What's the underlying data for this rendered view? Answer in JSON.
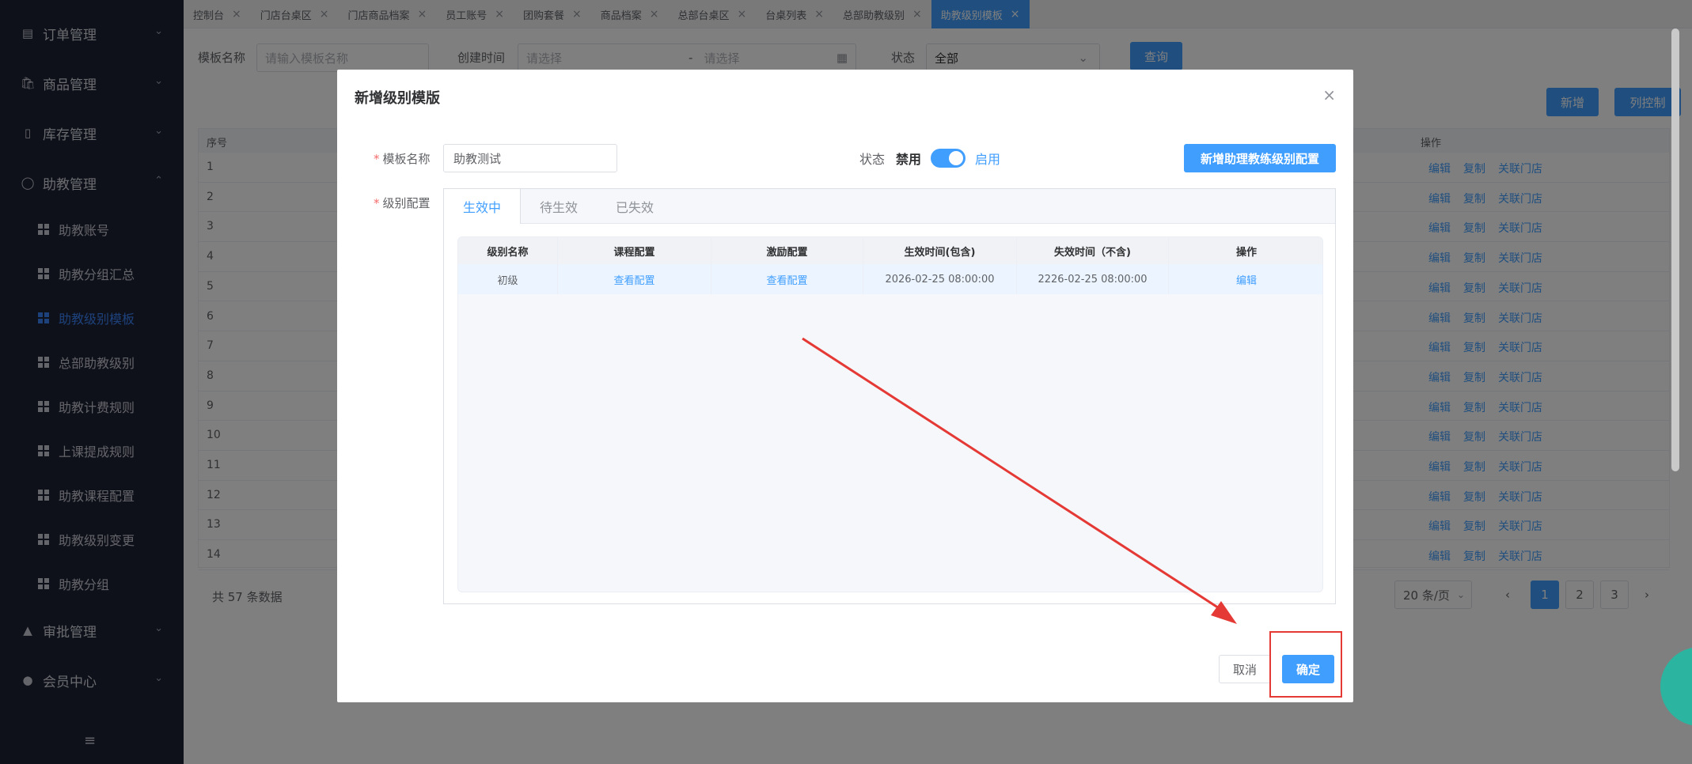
{
  "sidebar": {
    "groups": [
      {
        "label": "订单管理",
        "icon": "document-icon"
      },
      {
        "label": "商品管理",
        "icon": "bag-icon"
      },
      {
        "label": "库存管理",
        "icon": "inventory-icon"
      },
      {
        "label": "助教管理",
        "icon": "user-icon"
      },
      {
        "label": "审批管理",
        "icon": "stamp-icon"
      },
      {
        "label": "会员中心",
        "icon": "member-icon"
      }
    ],
    "assistant_items": [
      "助教账号",
      "助教分组汇总",
      "助教级别模板",
      "总部助教级别",
      "助教计费规则",
      "上课提成规则",
      "助教课程配置",
      "助教级别变更",
      "助教分组"
    ],
    "active_item": "助教级别模板",
    "collapse_icon": "≡"
  },
  "tabs": [
    "控制台",
    "门店台桌区",
    "门店商品档案",
    "员工账号",
    "团购套餐",
    "商品档案",
    "总部台桌区",
    "台桌列表",
    "总部助教级别",
    "助教级别模板"
  ],
  "filters": {
    "name_label": "模板名称",
    "name_placeholder": "请输入模板名称",
    "time_label": "创建时间",
    "start_placeholder": "请选择",
    "end_placeholder": "请选择",
    "status_label": "状态",
    "status_value": "全部",
    "query_button": "查询"
  },
  "toolbar": {
    "add_button": "新增",
    "column_button": "列控制"
  },
  "table": {
    "col_index": "序号",
    "col_ops": "操作",
    "rows": [
      "1",
      "2",
      "3",
      "4",
      "5",
      "6",
      "7",
      "8",
      "9",
      "10",
      "11",
      "12",
      "13",
      "14"
    ],
    "ops": [
      "编辑",
      "复制",
      "关联门店"
    ]
  },
  "pagination": {
    "total": "共 57 条数据",
    "page_size": "20 条/页",
    "pages": [
      "1",
      "2",
      "3"
    ],
    "current": "1",
    "prev": "‹",
    "next": "›"
  },
  "dialog": {
    "title": "新增级别模版",
    "name_label": "模板名称",
    "name_value": "助教测试",
    "status_label": "状态",
    "status_off": "禁用",
    "status_on": "启用",
    "add_level_button": "新增助理教练级别配置",
    "level_label": "级别配置",
    "level_tabs": [
      "生效中",
      "待生效",
      "已失效"
    ],
    "level_table": {
      "headers": [
        "级别名称",
        "课程配置",
        "激励配置",
        "生效时间(包含)",
        "失效时间（不含)",
        "操作"
      ],
      "rows": [
        {
          "name": "初级",
          "course": "查看配置",
          "incentive": "查看配置",
          "start": "2026-02-25 08:00:00",
          "end": "2226-02-25 08:00:00",
          "op": "编辑"
        }
      ]
    },
    "cancel_button": "取消",
    "ok_button": "确定"
  },
  "colors": {
    "primary": "#409eff",
    "sidebar_bg": "#1f2234",
    "annotation": "#e53935"
  }
}
